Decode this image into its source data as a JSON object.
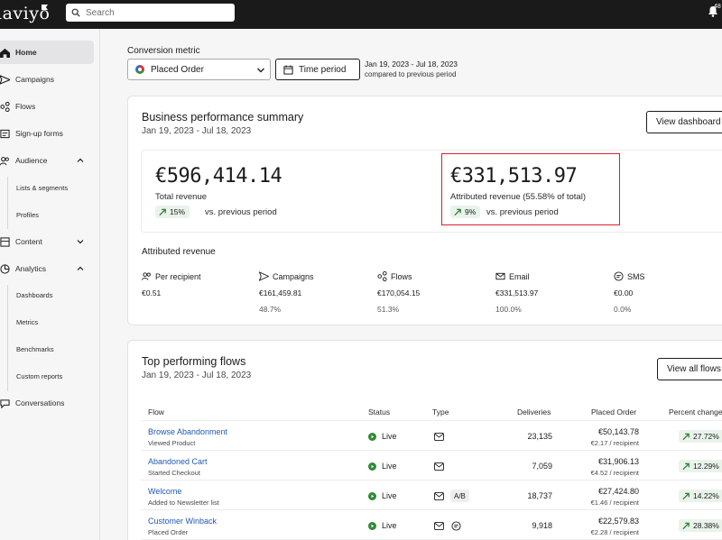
{
  "app": {
    "logo": "laviyo",
    "search_placeholder": "Search",
    "notifications": "48"
  },
  "sidebar": {
    "items": [
      {
        "label": "Home",
        "icon": "home-icon"
      },
      {
        "label": "Campaigns",
        "icon": "send-icon"
      },
      {
        "label": "Flows",
        "icon": "flow-icon"
      },
      {
        "label": "Sign-up forms",
        "icon": "form-icon"
      },
      {
        "label": "Audience",
        "icon": "audience-icon"
      },
      {
        "label": "Lists & segments"
      },
      {
        "label": "Profiles"
      },
      {
        "label": "Content",
        "icon": "content-icon"
      },
      {
        "label": "Analytics",
        "icon": "analytics-icon"
      },
      {
        "label": "Dashboards"
      },
      {
        "label": "Metrics"
      },
      {
        "label": "Benchmarks"
      },
      {
        "label": "Custom reports"
      },
      {
        "label": "Conversations",
        "icon": "conversations-icon"
      }
    ]
  },
  "header": {
    "conversion_label": "Conversion metric",
    "conversion_value": "Placed Order",
    "time_period": "Time period",
    "range": "Jan 19, 2023 - Jul 18, 2023",
    "compare": "compared to previous period"
  },
  "summary": {
    "title": "Business performance summary",
    "range": "Jan 19, 2023 - Jul 18, 2023",
    "view_button": "View dashboard",
    "total": {
      "value": "€596,414.14",
      "label": "Total revenue",
      "change": "15%",
      "vs": "vs. previous period"
    },
    "attributed": {
      "value": "€331,513.97",
      "label": "Attributed revenue (55.58% of total)",
      "change": "9%",
      "vs": "vs. previous period"
    },
    "attributed_title": "Attributed revenue",
    "breakdown": [
      {
        "label": "Per recipient",
        "value": "€0.51",
        "pct": ""
      },
      {
        "label": "Campaigns",
        "value": "€161,459.81",
        "pct": "48.7%"
      },
      {
        "label": "Flows",
        "value": "€170,054.15",
        "pct": "51.3%"
      },
      {
        "label": "Email",
        "value": "€331,513.97",
        "pct": "100.0%"
      },
      {
        "label": "SMS",
        "value": "€0.00",
        "pct": "0.0%"
      }
    ]
  },
  "flows": {
    "title": "Top performing flows",
    "range": "Jan 19, 2023 - Jul 18, 2023",
    "view_button": "View all flows",
    "columns": {
      "flow": "Flow",
      "status": "Status",
      "type": "Type",
      "deliveries": "Deliveries",
      "placed": "Placed Order",
      "pct": "Percent change"
    },
    "rows": [
      {
        "name": "Browse Abandonment",
        "sub": "Viewed Product",
        "status": "Live",
        "ab": "",
        "sms": false,
        "deliveries": "23,135",
        "placed": "€50,143.78",
        "per": "€2.17 / recipient",
        "change": "27.72%"
      },
      {
        "name": "Abandoned Cart",
        "sub": "Started Checkout",
        "status": "Live",
        "ab": "",
        "sms": false,
        "deliveries": "7,059",
        "placed": "€31,906.13",
        "per": "€4.52 / recipient",
        "change": "12.29%"
      },
      {
        "name": "Welcome",
        "sub": "Added to Newsletter list",
        "status": "Live",
        "ab": "A/B",
        "sms": false,
        "deliveries": "18,737",
        "placed": "€27,424.80",
        "per": "€1.46 / recipient",
        "change": "14.22%"
      },
      {
        "name": "Customer Winback",
        "sub": "Placed Order",
        "status": "Live",
        "ab": "",
        "sms": true,
        "deliveries": "9,918",
        "placed": "€22,579.83",
        "per": "€2.28 / recipient",
        "change": "28.38%"
      }
    ]
  }
}
